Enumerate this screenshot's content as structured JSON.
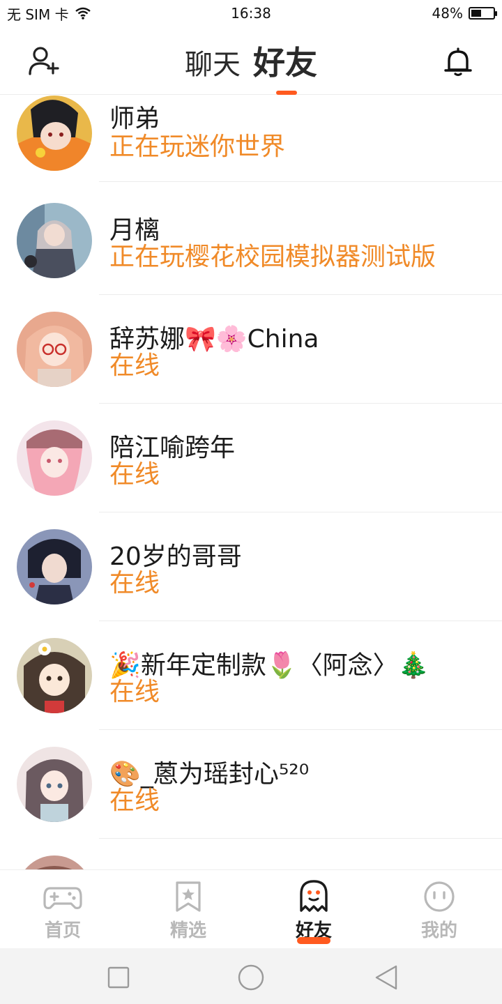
{
  "status_bar": {
    "carrier": "无 SIM 卡",
    "time": "16:38",
    "battery_percent": "48%",
    "battery_level": 0.48
  },
  "header": {
    "tab_chat": "聊天",
    "tab_friends": "好友",
    "active_tab": "好友",
    "accent_color": "#ff5a1f"
  },
  "friends": [
    {
      "name": "师弟",
      "status": "正在玩迷你世界"
    },
    {
      "name": "月樆",
      "status": "正在玩樱花校园模拟器测试版"
    },
    {
      "name": "辞苏娜🎀🌸China",
      "status": "在线"
    },
    {
      "name": "陪江喻跨年",
      "status": "在线"
    },
    {
      "name": "20岁的哥哥",
      "status": "在线"
    },
    {
      "name": "🎉新年定制款🌷〈阿念〉🎄",
      "status": "在线"
    },
    {
      "name": "🎨_蒽为瑶封心⁵²⁰",
      "status": "在线"
    }
  ],
  "status_color": "#f08a28",
  "tabbar": {
    "items": [
      {
        "label": "首页",
        "icon": "gamepad-icon"
      },
      {
        "label": "精选",
        "icon": "star-bookmark-icon"
      },
      {
        "label": "好友",
        "icon": "ghost-icon"
      },
      {
        "label": "我的",
        "icon": "face-icon"
      }
    ],
    "active": "好友"
  },
  "system_nav": {
    "icons": [
      "square-recents-icon",
      "circle-home-icon",
      "triangle-back-icon"
    ]
  }
}
